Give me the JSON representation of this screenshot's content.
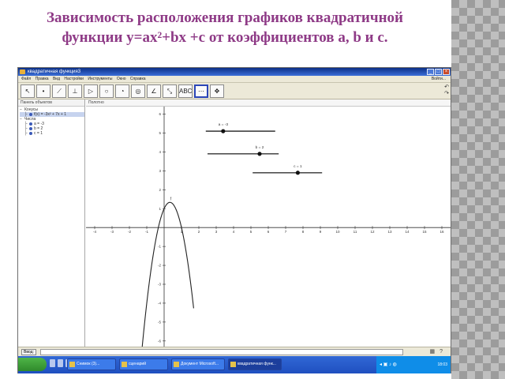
{
  "slide": {
    "title_line1": "Зависимость расположения графиков квадратичной",
    "title_line2": "функции y=ax²+bx +c от коэффициентов a, b и c."
  },
  "window": {
    "title": "квадратичная функция3",
    "menu": [
      "Файл",
      "Правка",
      "Вид",
      "Настройки",
      "Инструменты",
      "Окно",
      "Справка"
    ],
    "menu_right": "Войти..."
  },
  "algebra": {
    "header": "Панель объектов",
    "tree": [
      {
        "text": "Конусы",
        "indent": 0
      },
      {
        "text": "f(x) = -3x² + 7x + 1",
        "indent": 1,
        "selected": true
      },
      {
        "text": "Числа",
        "indent": 0
      },
      {
        "text": "a = -3",
        "indent": 1
      },
      {
        "text": "b = 2",
        "indent": 1
      },
      {
        "text": "c = 1",
        "indent": 1
      }
    ]
  },
  "graphics": {
    "header": "Полотно"
  },
  "chart_data": {
    "type": "line",
    "x_ticks": [
      -4,
      -3,
      -2,
      -1,
      1,
      2,
      3,
      4,
      5,
      6,
      7,
      8,
      9,
      10,
      11,
      12,
      13,
      14,
      15,
      16
    ],
    "y_ticks": [
      -6,
      -5,
      -4,
      -3,
      -2,
      -1,
      1,
      2,
      3,
      4,
      5,
      6
    ],
    "xlim": [
      -4.5,
      16.5
    ],
    "ylim": [
      -6.3,
      6.4
    ],
    "series": [
      {
        "label": "f",
        "formula": "-3x^2 + 2x + 1",
        "color": "#222222"
      }
    ],
    "sliders": [
      {
        "label": "a = -3",
        "x0": 2.4,
        "x1": 6.4,
        "y": 5.1,
        "value_x": 3.4
      },
      {
        "label": "b = 2",
        "x0": 2.5,
        "x1": 6.6,
        "y": 3.9,
        "value_x": 5.5
      },
      {
        "label": "c = 1",
        "x0": 5.1,
        "x1": 9.1,
        "y": 2.9,
        "value_x": 7.7
      }
    ],
    "grid": false
  },
  "inputbar": {
    "label": "Ввод:"
  },
  "taskbar": {
    "tasks": [
      "Снимок (3)...",
      "сценарий",
      "Документ Microsoft...",
      "квадратичная функ..."
    ],
    "clock": "18:03"
  }
}
